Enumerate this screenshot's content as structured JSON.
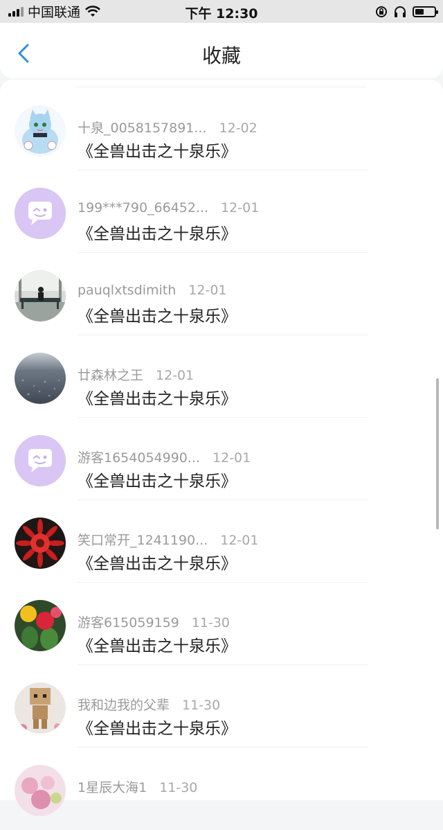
{
  "status_bar": {
    "carrier": "中国联通",
    "time": "下午 12:30"
  },
  "header": {
    "title": "收藏"
  },
  "items": [
    {
      "name": "十泉_0058157891...",
      "date": "12-02",
      "book": "《全兽出击之十泉乐》",
      "avatar": "cat-illustration"
    },
    {
      "name": "199***790_66452...",
      "date": "12-01",
      "book": "《全兽出击之十泉乐》",
      "avatar": "default-chat"
    },
    {
      "name": "pauqlxtsdimith",
      "date": "12-01",
      "book": "《全兽出击之十泉乐》",
      "avatar": "person-bench"
    },
    {
      "name": "廿森林之王",
      "date": "12-01",
      "book": "《全兽出击之十泉乐》",
      "avatar": "rain-water"
    },
    {
      "name": "游客1654054990...",
      "date": "12-01",
      "book": "《全兽出击之十泉乐》",
      "avatar": "default-chat"
    },
    {
      "name": "笑口常开_1241190...",
      "date": "12-01",
      "book": "《全兽出击之十泉乐》",
      "avatar": "red-flower"
    },
    {
      "name": "游客615059159",
      "date": "11-30",
      "book": "《全兽出击之十泉乐》",
      "avatar": "cactus-flowers"
    },
    {
      "name": "我和边我的父辈",
      "date": "11-30",
      "book": "《全兽出击之十泉乐》",
      "avatar": "danbo-figure"
    },
    {
      "name": "1星辰大海1",
      "date": "11-30",
      "book": "",
      "avatar": "pink-flowers"
    }
  ]
}
